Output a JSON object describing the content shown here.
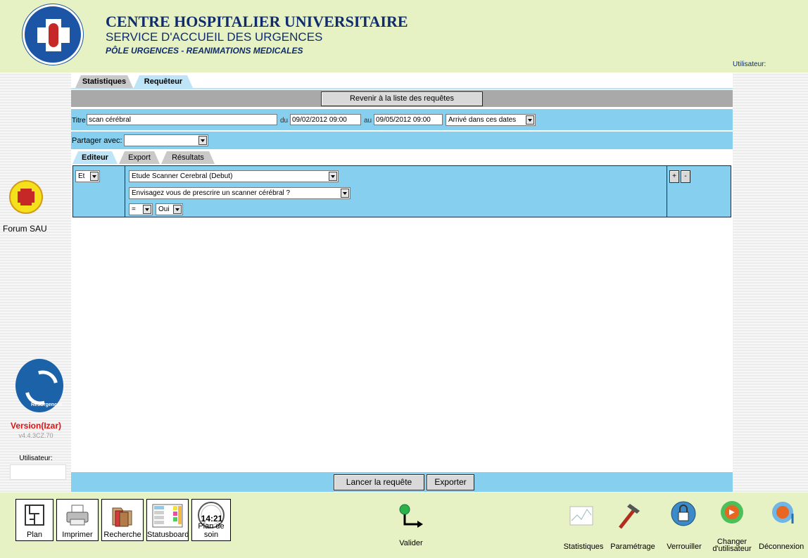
{
  "header": {
    "title": "CENTRE HOSPITALIER UNIVERSITAIRE",
    "subtitle": "SERVICE D'ACCUEIL DES URGENCES",
    "pole": "PÔLE URGENCES - REANIMATIONS MEDICALES",
    "user_label": "Utilisateur:"
  },
  "top_tabs": [
    {
      "label": "Statistiques",
      "active": false
    },
    {
      "label": "Requêteur",
      "active": true
    }
  ],
  "back_button": "Revenir à la liste des requêtes",
  "query": {
    "title_label": "Titre",
    "title_value": "scan cérébral",
    "from_label": "du",
    "from_value": "09/02/2012 09:00",
    "to_label": "au",
    "to_value": "09/05/2012 09:00",
    "date_mode": "Arrivé dans ces dates",
    "share_label": "Partager avec:",
    "share_value": ""
  },
  "sub_tabs": [
    {
      "label": "Editeur",
      "active": true
    },
    {
      "label": "Export",
      "active": false
    },
    {
      "label": "Résultats",
      "active": false
    }
  ],
  "criteria": {
    "operator": "Et",
    "field": "Etude Scanner Cerebral (Debut)",
    "question": "Envisagez vous de prescrire un scanner cérébral ?",
    "comparator": "=",
    "value": "Oui",
    "add_label": "+",
    "remove_label": "-"
  },
  "bottom_actions": {
    "run": "Lancer la requête",
    "export": "Exporter"
  },
  "left_panel": {
    "forum": "Forum SAU",
    "version": "Version(Izar)",
    "version_number": "v4.4.3CZ.70",
    "user_label": "Utilisateur:",
    "resu_logo_text": "ResUrgences"
  },
  "footer": {
    "left_buttons": [
      {
        "label": "Plan",
        "icon": "floorplan-icon"
      },
      {
        "label": "Imprimer",
        "icon": "printer-icon"
      },
      {
        "label": "Recherche",
        "icon": "folders-icon"
      },
      {
        "label": "Statusboard",
        "icon": "statusboard-icon"
      },
      {
        "label": "Plan de soin",
        "icon": "clock-icon"
      }
    ],
    "clock_time": "14:21",
    "validate": "Valider",
    "right_buttons": [
      {
        "label": "Statistiques",
        "icon": "chart-icon"
      },
      {
        "label": "Paramétrage",
        "icon": "hammer-icon"
      },
      {
        "label": "Verrouiller",
        "icon": "lock-icon"
      },
      {
        "label": "Changer d'utilisateur",
        "icon": "switch-user-icon"
      },
      {
        "label": "Déconnexion",
        "icon": "logout-icon"
      }
    ]
  }
}
